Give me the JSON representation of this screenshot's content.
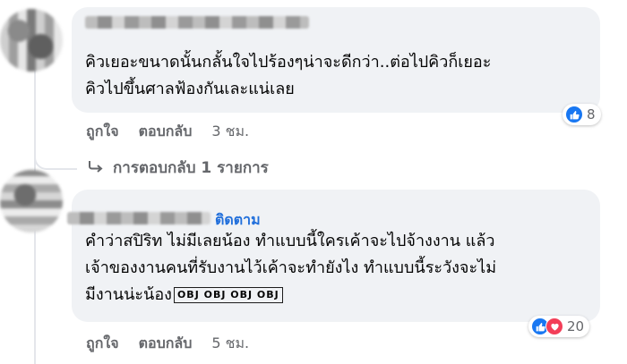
{
  "comment1": {
    "text_line1": "คิวเยอะขนาดนั้นกลั้นใจไปร้องๆน่าจะดีกว่า..ต่อไปคิวก็เยอะ",
    "text_line2": "คิวไปขึ้นศาลฟ้องกันเละแน่เลย",
    "reaction_count": "8",
    "reactions": [
      "like-icon"
    ],
    "like_label": "ถูกใจ",
    "reply_label": "ตอบกลับ",
    "time": "3 ชม.",
    "view_replies": "การตอบกลับ 1 รายการ"
  },
  "comment2": {
    "follow_label": "ติดตาม",
    "text_line1": "คำว่าสปิริท ไม่มีเลยน้อง ทำแบบนี้ใครเค้าจะไปจ้างงาน แล้ว",
    "text_line2": "เจ้าของงานคนที่รับงานไว้เค้าจะทำยังไง ทำแบบนี้ระวังจะไม่",
    "text_line3": "มีงานน่ะน้อง",
    "emoji_text": "OBJ OBJ OBJ OBJ",
    "reaction_count": "20",
    "reactions": [
      "like-icon",
      "love-icon"
    ],
    "like_label": "ถูกใจ",
    "reply_label": "ตอบกลับ",
    "time": "5 ชม."
  },
  "colors": {
    "bubble": "#f0f2f5",
    "link": "#216fdb",
    "meta": "#65676b",
    "like": "#1877f2",
    "love": "#f33e58"
  }
}
